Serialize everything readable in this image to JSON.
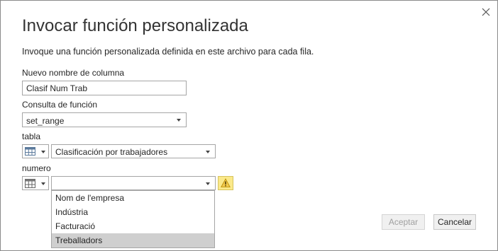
{
  "dialog": {
    "title": "Invocar función personalizada",
    "description": "Invoque una función personalizada definida en este archivo para cada fila."
  },
  "fields": {
    "column_name": {
      "label": "Nuevo nombre de columna",
      "value": "Clasif Num Trab"
    },
    "function_query": {
      "label": "Consulta de función",
      "value": "set_range"
    },
    "tabla": {
      "label": "tabla",
      "value": "Clasificación por trabajadores",
      "type_icon": "table-icon"
    },
    "numero": {
      "label": "numero",
      "value": "",
      "type_icon": "table-icon",
      "warning_icon": "warning-icon"
    }
  },
  "dropdown": {
    "open": true,
    "options": [
      "Nom de l'empresa",
      "Indústria",
      "Facturació",
      "Treballadors"
    ],
    "highlighted": "Treballadors"
  },
  "buttons": {
    "accept": "Aceptar",
    "cancel": "Cancelar"
  },
  "colors": {
    "warning_fill": "#fbe98a",
    "highlight": "#cfcfcf"
  }
}
